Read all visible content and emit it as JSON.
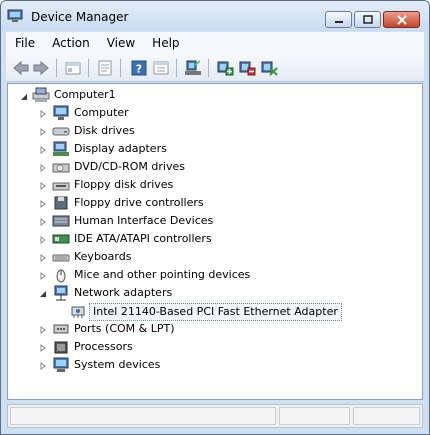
{
  "window": {
    "title": "Device Manager"
  },
  "menu": {
    "items": [
      "File",
      "Action",
      "View",
      "Help"
    ]
  },
  "toolbar": {
    "buttons": [
      "back-arrow-icon",
      "forward-arrow-icon",
      "up-level-icon",
      "properties-icon",
      "help-icon",
      "show-hide-console-tree-icon",
      "scan-hardware-icon",
      "update-driver-icon",
      "disable-device-icon",
      "uninstall-device-icon"
    ]
  },
  "tree": {
    "root": "Computer1",
    "categories": [
      {
        "label": "Computer",
        "icon": "monitor-icon"
      },
      {
        "label": "Disk drives",
        "icon": "disk-drive-icon"
      },
      {
        "label": "Display adapters",
        "icon": "display-adapter-icon"
      },
      {
        "label": "DVD/CD-ROM drives",
        "icon": "dvd-drive-icon"
      },
      {
        "label": "Floppy disk drives",
        "icon": "floppy-drive-icon"
      },
      {
        "label": "Floppy drive controllers",
        "icon": "floppy-controller-icon"
      },
      {
        "label": "Human Interface Devices",
        "icon": "hid-icon"
      },
      {
        "label": "IDE ATA/ATAPI controllers",
        "icon": "ide-controller-icon"
      },
      {
        "label": "Keyboards",
        "icon": "keyboard-icon"
      },
      {
        "label": "Mice and other pointing devices",
        "icon": "mouse-icon"
      },
      {
        "label": "Network adapters",
        "icon": "network-adapter-icon",
        "expanded": true
      },
      {
        "label": "Ports (COM & LPT)",
        "icon": "port-icon"
      },
      {
        "label": "Processors",
        "icon": "processor-icon"
      },
      {
        "label": "System devices",
        "icon": "system-device-icon"
      }
    ],
    "network_child": "Intel 21140-Based PCI Fast Ethernet Adapter"
  },
  "colors": {
    "titlebar": "#c7dbf2",
    "close_button": "#c5432a",
    "selection_border": "#6d8fb5"
  }
}
